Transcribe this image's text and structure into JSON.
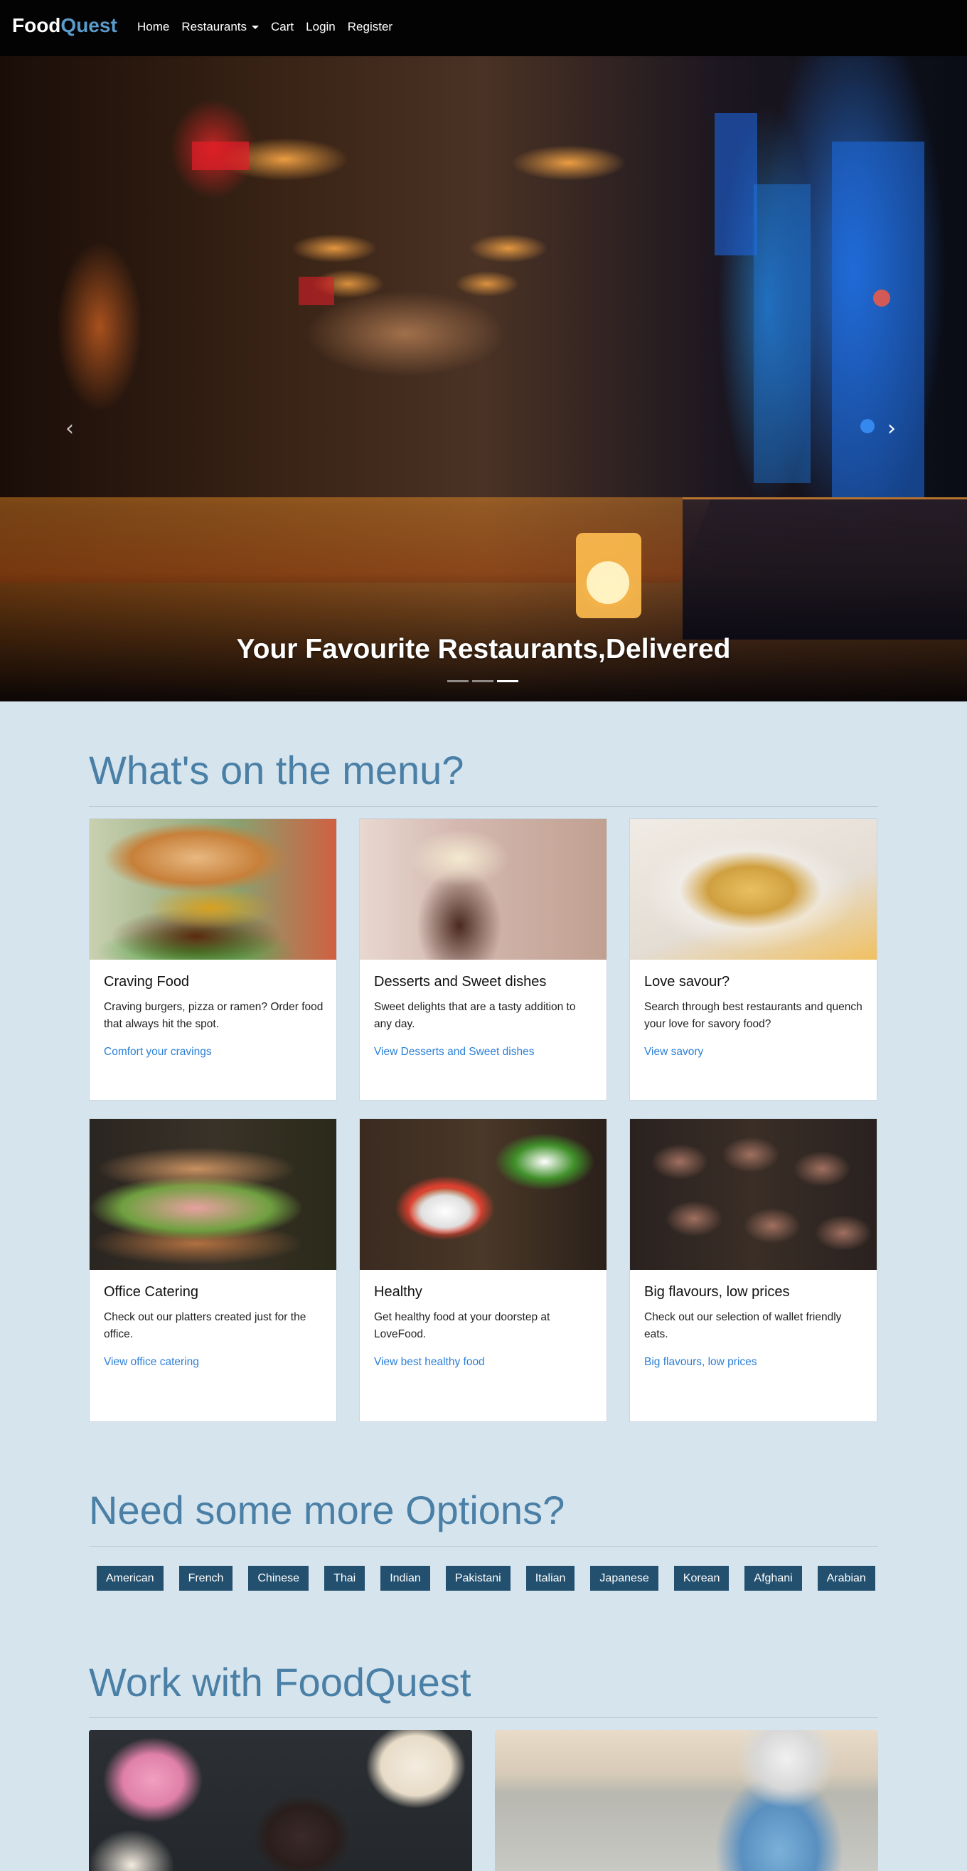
{
  "navbar": {
    "brand_part1": "Food",
    "brand_part2": "Quest",
    "links": [
      "Home",
      "Restaurants",
      "Cart",
      "Login",
      "Register"
    ]
  },
  "hero": {
    "caption": "Your Favourite Restaurants,Delivered",
    "prev_icon": "‹",
    "next_icon": "›",
    "active_slide": 3,
    "slide_count": 3
  },
  "menu_section": {
    "title": "What's on the menu?",
    "cards": [
      {
        "title": "Craving Food",
        "text": "Craving burgers, pizza or ramen? Order food that always hit the spot.",
        "link": "Comfort your cravings",
        "image": "burger-image"
      },
      {
        "title": "Desserts and Sweet dishes",
        "text": "Sweet delights that are a tasty addition to any day.",
        "link": "View Desserts and Sweet dishes",
        "image": "milkshake-image"
      },
      {
        "title": "Love savour?",
        "text": "Search through best restaurants and quench your love for savory food?",
        "link": "View savory",
        "image": "pasta-image"
      },
      {
        "title": "Office Catering",
        "text": "Check out our platters created just for the office.",
        "link": "View office catering",
        "image": "sandwich-image"
      },
      {
        "title": "Healthy",
        "text": "Get healthy food at your doorstep at LoveFood.",
        "link": "View best healthy food",
        "image": "salad-image"
      },
      {
        "title": "Big flavours, low prices",
        "text": "Check out our selection of wallet friendly eats.",
        "link": "Big flavours, low prices",
        "image": "grilled-meat-image"
      }
    ]
  },
  "options_section": {
    "title": "Need some more Options?",
    "tags": [
      "American",
      "French",
      "Chinese",
      "Thai",
      "Indian",
      "Pakistani",
      "Italian",
      "Japanese",
      "Korean",
      "Afghani",
      "Arabian"
    ]
  },
  "work_section": {
    "title": "Work with FoodQuest",
    "cards": [
      {
        "image": "donuts-image"
      },
      {
        "image": "delivery-rider-image"
      }
    ]
  },
  "colors": {
    "background": "#d6e4ee",
    "navbar": "#030303",
    "brand_accent": "#5b9bcb",
    "heading": "#4a7fa6",
    "link": "#2b7fd8",
    "tag": "#23506e"
  }
}
